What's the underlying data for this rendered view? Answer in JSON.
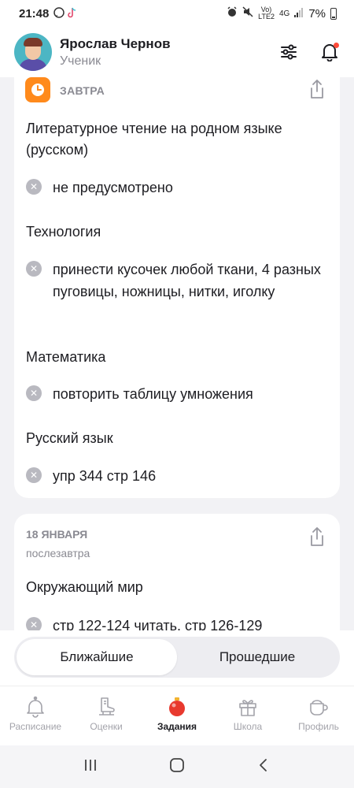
{
  "status": {
    "time": "21:48",
    "network_top": "Vo)",
    "network_bottom": "LTE2",
    "signal": "4G",
    "battery": "7%"
  },
  "header": {
    "user_name": "Ярослав Чернов",
    "user_role": "Ученик"
  },
  "card1": {
    "day_label": "ЗАВТРА",
    "items": [
      {
        "subject": "Литературное чтение на родном языке (русском)",
        "task": "не предусмотрено"
      },
      {
        "subject": "Технология",
        "task": "принести кусочек любой ткани, 4 разных пуговицы, ножницы, нитки, иголку"
      },
      {
        "subject": "Математика",
        "task": "повторить таблицу умножения"
      },
      {
        "subject": "Русский язык",
        "task": "упр 344 стр 146"
      }
    ]
  },
  "card2": {
    "date_label": "18 ЯНВАРЯ",
    "date_sub": "послезавтра",
    "items": [
      {
        "subject": "Окружающий мир",
        "task": "стр 122-124 читать, стр 126-129"
      }
    ]
  },
  "tabs": {
    "upcoming": "Ближайшие",
    "past": "Прошедшие",
    "active": "upcoming"
  },
  "bottom_nav": [
    {
      "label": "Расписание",
      "icon": "bell-icon"
    },
    {
      "label": "Оценки",
      "icon": "skate-icon"
    },
    {
      "label": "Задания",
      "icon": "ornament-icon",
      "active": true
    },
    {
      "label": "Школа",
      "icon": "gift-icon"
    },
    {
      "label": "Профиль",
      "icon": "cup-icon"
    }
  ],
  "colors": {
    "accent_orange": "#ff8a1c",
    "notification_dot": "#ff4b3a",
    "ornament_red": "#e8392e"
  }
}
